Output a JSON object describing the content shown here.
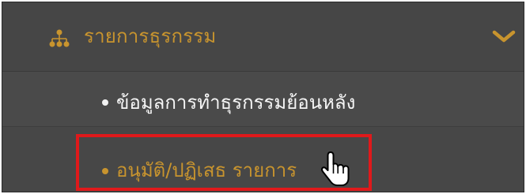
{
  "colors": {
    "accent": "#c8942e",
    "background": "#474747",
    "highlight": "#e0191b"
  },
  "menu": {
    "title": "รายการธุรกรรม",
    "icon": "hierarchy-icon",
    "expand_icon": "chevron-down-icon"
  },
  "items": [
    {
      "label": "ข้อมูลการทำธุรกรรมย้อนหลัง"
    },
    {
      "label": "อนุมัติ/ปฏิเสธ รายการ"
    }
  ],
  "cursor_icon": "hand-pointer-icon"
}
